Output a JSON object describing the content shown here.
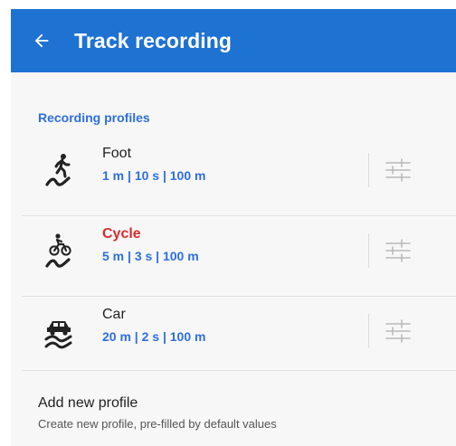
{
  "header": {
    "title": "Track recording",
    "back_icon": "arrow-left-icon",
    "background_color": "#1e72d2"
  },
  "section": {
    "title": "Recording profiles",
    "accent_color": "#2d6fe0"
  },
  "profiles": [
    {
      "name": "Foot",
      "values": "1 m | 10 s | 100 m",
      "icon": "walking-track-icon",
      "active": false
    },
    {
      "name": "Cycle",
      "values": "5 m | 3 s | 100 m",
      "icon": "cycling-track-icon",
      "active": true
    },
    {
      "name": "Car",
      "values": "20 m | 2 s | 100 m",
      "icon": "car-track-icon",
      "active": false
    }
  ],
  "add_profile": {
    "title": "Add new profile",
    "subtitle": "Create new profile, pre-filled by default values"
  },
  "colors": {
    "active_profile": "#d92b2b",
    "values_text": "#2d6fe0"
  }
}
